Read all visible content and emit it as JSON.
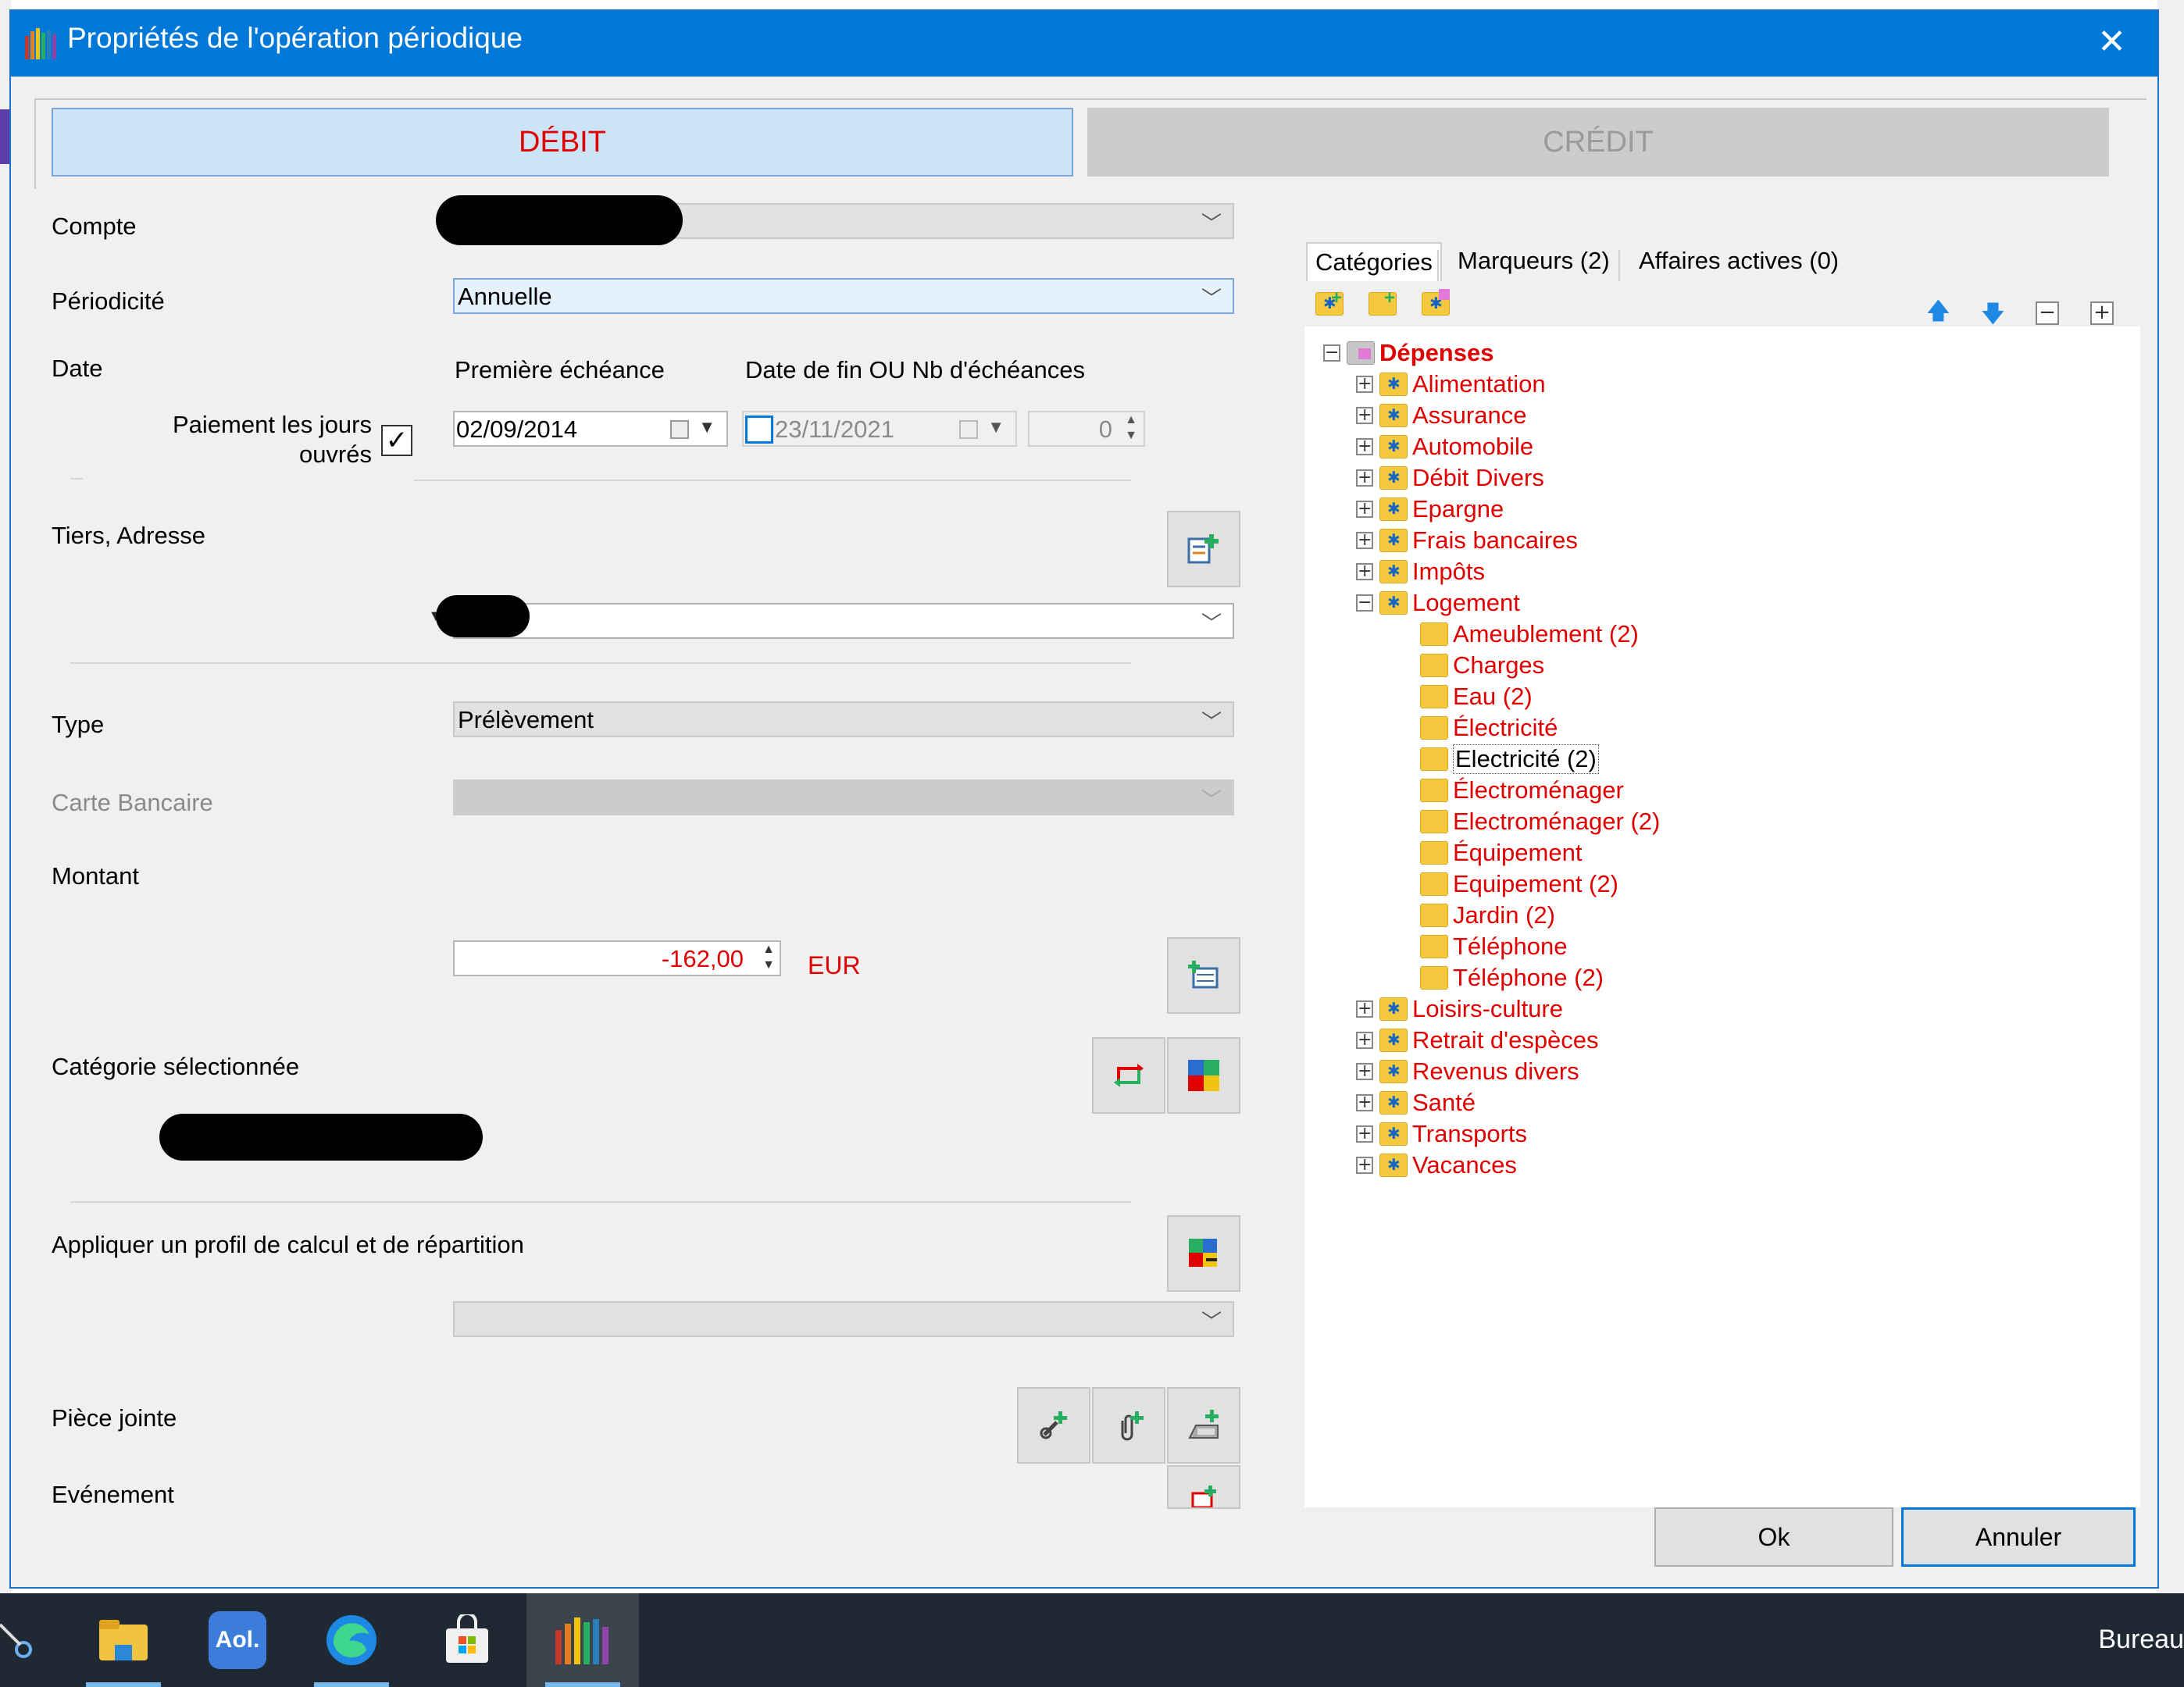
{
  "window": {
    "title": "Propriétés de l'opération périodique"
  },
  "mode": {
    "debit_label": "DÉBIT",
    "credit_label": "CRÉDIT"
  },
  "form": {
    "compte_label": "Compte",
    "periodicite_label": "Périodicité",
    "periodicite_value": "Annuelle",
    "date_label": "Date",
    "premiere_echeance_label": "Première échéance",
    "date_fin_label": "Date de fin OU Nb d'échéances",
    "paiement_label_1": "Paiement les jours",
    "paiement_label_2": "ouvrés",
    "paiement_checked": true,
    "premiere_echeance_value": "02/09/2014",
    "date_fin_value": "23/11/2021",
    "date_fin_checked": false,
    "nb_echeances_value": "0",
    "tiers_label": "Tiers, Adresse",
    "type_label": "Type",
    "type_value": "Prélèvement",
    "carte_label": "Carte Bancaire",
    "montant_label": "Montant",
    "montant_value": "-162,00",
    "currency": "EUR",
    "categorie_label": "Catégorie sélectionnée",
    "profil_label": "Appliquer un profil de calcul et de répartition",
    "piece_label": "Pièce jointe",
    "evenement_label": "Evénement"
  },
  "tabs": [
    {
      "label": "Catégories",
      "active": true
    },
    {
      "label": "Marqueurs (2)",
      "active": false
    },
    {
      "label": "Affaires actives (0)",
      "active": false
    }
  ],
  "tree": {
    "root": "Dépenses",
    "children": [
      {
        "label": "Alimentation",
        "expanded": false
      },
      {
        "label": "Assurance",
        "expanded": false
      },
      {
        "label": "Automobile",
        "expanded": false
      },
      {
        "label": "Débit Divers",
        "expanded": false
      },
      {
        "label": "Epargne",
        "expanded": false
      },
      {
        "label": "Frais bancaires",
        "expanded": false
      },
      {
        "label": "Impôts",
        "expanded": false
      },
      {
        "label": "Logement",
        "expanded": true,
        "children": [
          {
            "label": "Ameublement (2)",
            "color": "red"
          },
          {
            "label": "Charges",
            "color": "red"
          },
          {
            "label": "Eau (2)",
            "color": "red"
          },
          {
            "label": "Électricité",
            "color": "red"
          },
          {
            "label": "Electricité (2)",
            "color": "black",
            "selected": true
          },
          {
            "label": "Électroménager",
            "color": "red"
          },
          {
            "label": "Electroménager (2)",
            "color": "red"
          },
          {
            "label": "Équipement",
            "color": "red"
          },
          {
            "label": "Equipement (2)",
            "color": "red"
          },
          {
            "label": "Jardin (2)",
            "color": "red"
          },
          {
            "label": "Téléphone",
            "color": "red"
          },
          {
            "label": "Téléphone (2)",
            "color": "red"
          }
        ]
      },
      {
        "label": "Loisirs-culture",
        "expanded": false
      },
      {
        "label": "Retrait d'espèces",
        "expanded": false
      },
      {
        "label": "Revenus divers",
        "expanded": false
      },
      {
        "label": "Santé",
        "expanded": false
      },
      {
        "label": "Transports",
        "expanded": false
      },
      {
        "label": "Vacances",
        "expanded": false
      }
    ]
  },
  "buttons": {
    "ok": "Ok",
    "cancel": "Annuler"
  },
  "taskbar": {
    "items": [
      "snipping-tool",
      "file-explorer",
      "aol",
      "edge",
      "microsoft-store",
      "money-app"
    ],
    "aol_label": "Aol.",
    "right_text": "Bureau"
  },
  "colors": {
    "accent": "#0078d7",
    "debit_red": "#e00000",
    "debit_bg": "#cce4f7"
  }
}
